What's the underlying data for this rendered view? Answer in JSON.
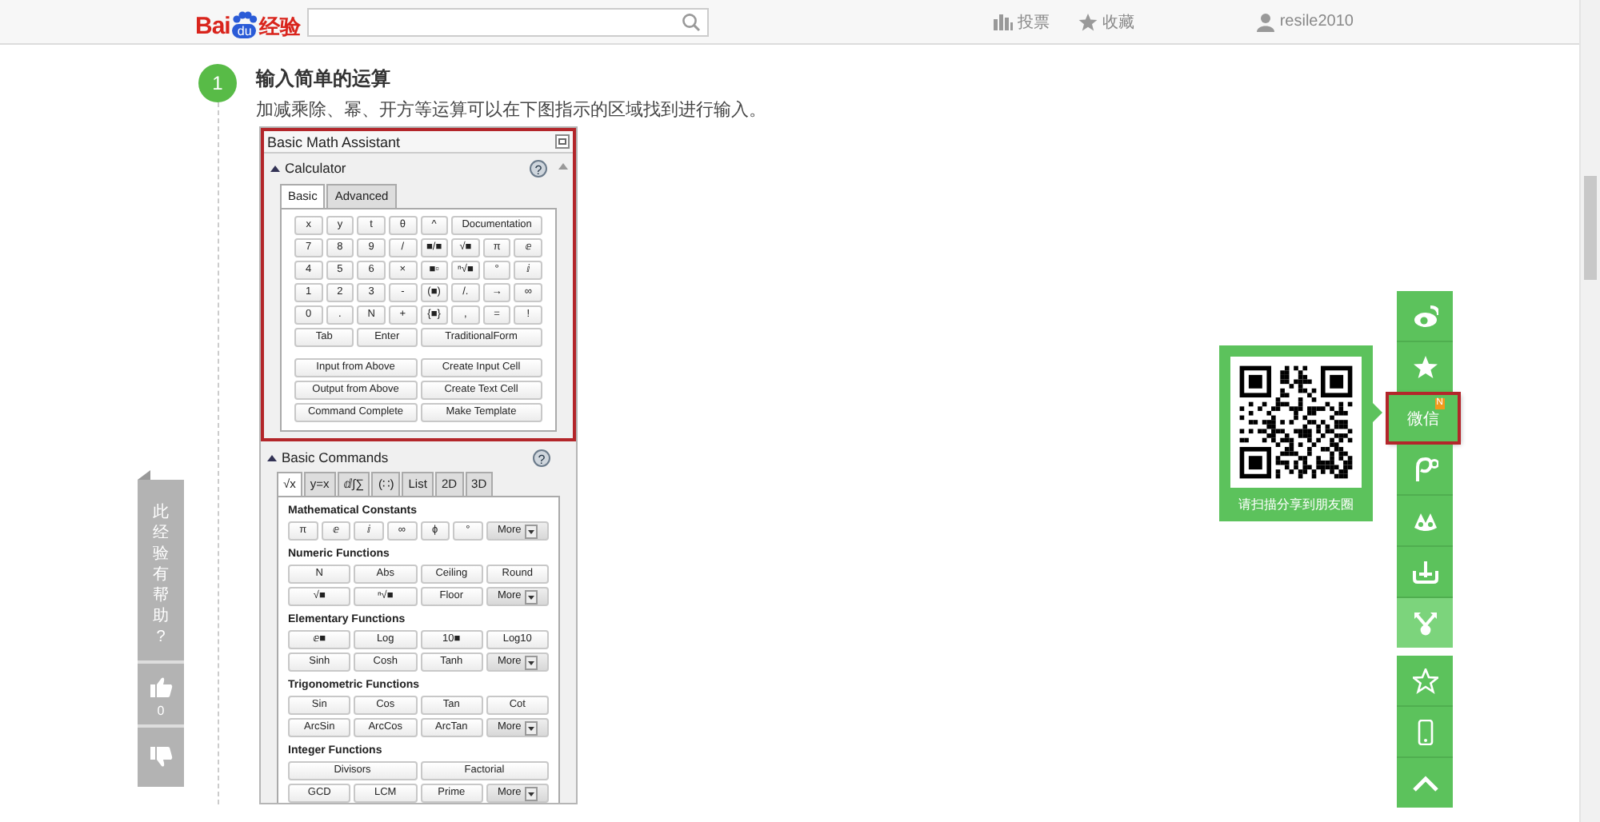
{
  "header": {
    "logo": {
      "brand": "Bai",
      "paw": "du",
      "suffix": "经验"
    },
    "nav": [
      {
        "kind": "chart",
        "label": "投票"
      },
      {
        "kind": "star",
        "label": "收藏"
      }
    ],
    "user": "resile2010"
  },
  "step": {
    "number": "1",
    "title": "输入简单的运算",
    "description": "加减乘除、幂、开方等运算可以在下图指示的区域找到进行输入。"
  },
  "panel": {
    "title": "Basic Math Assistant",
    "calculator": {
      "title": "Calculator",
      "help": "?",
      "highlighted": true,
      "tabs": [
        {
          "label": "Basic",
          "selected": true
        },
        {
          "label": "Advanced",
          "selected": false
        }
      ],
      "key_rows": [
        [
          "x",
          "y",
          "t",
          "θ",
          "^",
          "Documentation"
        ],
        [
          "7",
          "8",
          "9",
          "/",
          "■/■",
          "√■",
          "π",
          "ⅇ"
        ],
        [
          "4",
          "5",
          "6",
          "×",
          "■▫",
          "ⁿ√■",
          "°",
          "ⅈ"
        ],
        [
          "1",
          "2",
          "3",
          "-",
          "(■)",
          "/.",
          "→",
          "∞"
        ],
        [
          "0",
          ".",
          "N",
          "+",
          "{■}",
          ",",
          "=",
          "!"
        ],
        [
          "Tab",
          "Enter",
          "TraditionalForm"
        ]
      ],
      "action_rows": [
        [
          "Input from Above",
          "Create Input Cell"
        ],
        [
          "Output from Above",
          "Create Text Cell"
        ],
        [
          "Command Complete",
          "Make Template"
        ]
      ]
    },
    "commands": {
      "title": "Basic Commands",
      "help": "?",
      "tabs": [
        {
          "label": "√x",
          "selected": true
        },
        {
          "label": "y=x",
          "selected": false
        },
        {
          "label": "ⅆ∫∑",
          "selected": false
        },
        {
          "label": "(∷)",
          "selected": false
        },
        {
          "label": "List",
          "selected": false
        },
        {
          "label": "2D",
          "selected": false
        },
        {
          "label": "3D",
          "selected": false
        }
      ],
      "groups": [
        {
          "title": "Mathematical Constants",
          "rows": [
            [
              {
                "label": "π"
              },
              {
                "label": "ⅇ"
              },
              {
                "label": "ⅈ"
              },
              {
                "label": "∞"
              },
              {
                "label": "ϕ"
              },
              {
                "label": "°"
              },
              {
                "label": "More",
                "kind": "dropdown"
              }
            ]
          ]
        },
        {
          "title": "Numeric Functions",
          "rows": [
            [
              {
                "label": "N"
              },
              {
                "label": "Abs"
              },
              {
                "label": "Ceiling"
              },
              {
                "label": "Round"
              }
            ],
            [
              {
                "label": "√■"
              },
              {
                "label": "ⁿ√■"
              },
              {
                "label": "Floor"
              },
              {
                "label": "More",
                "kind": "dropdown"
              }
            ]
          ]
        },
        {
          "title": "Elementary Functions",
          "rows": [
            [
              {
                "label": "ⅇ■"
              },
              {
                "label": "Log"
              },
              {
                "label": "10■"
              },
              {
                "label": "Log10"
              }
            ],
            [
              {
                "label": "Sinh"
              },
              {
                "label": "Cosh"
              },
              {
                "label": "Tanh"
              },
              {
                "label": "More",
                "kind": "dropdown"
              }
            ]
          ]
        },
        {
          "title": "Trigonometric Functions",
          "rows": [
            [
              {
                "label": "Sin"
              },
              {
                "label": "Cos"
              },
              {
                "label": "Tan"
              },
              {
                "label": "Cot"
              }
            ],
            [
              {
                "label": "ArcSin"
              },
              {
                "label": "ArcCos"
              },
              {
                "label": "ArcTan"
              },
              {
                "label": "More",
                "kind": "dropdown"
              }
            ]
          ]
        },
        {
          "title": "Integer Functions",
          "rows": [
            [
              {
                "label": "Divisors"
              },
              {
                "label": "Factorial"
              }
            ],
            [
              {
                "label": "GCD"
              },
              {
                "label": "LCM"
              },
              {
                "label": "Prime"
              },
              {
                "label": "More",
                "kind": "dropdown"
              }
            ]
          ]
        }
      ]
    }
  },
  "vote": {
    "question": "此经验有帮助?",
    "likes": "0"
  },
  "share_bar": {
    "groups": [
      [
        {
          "kind": "eye",
          "selected": false
        },
        {
          "kind": "star",
          "selected": false
        },
        {
          "kind": "text",
          "label": "微信",
          "badge": "N",
          "selected": true
        },
        {
          "kind": "loop",
          "selected": false
        },
        {
          "kind": "petals",
          "selected": false
        },
        {
          "kind": "tray",
          "selected": false
        },
        {
          "kind": "fork",
          "selected": false
        }
      ],
      [
        {
          "kind": "star-outline",
          "selected": false
        },
        {
          "kind": "phone",
          "selected": false
        },
        {
          "kind": "up",
          "selected": false
        }
      ]
    ]
  },
  "qr_popup": {
    "caption": "请扫描分享到朋友圈"
  }
}
